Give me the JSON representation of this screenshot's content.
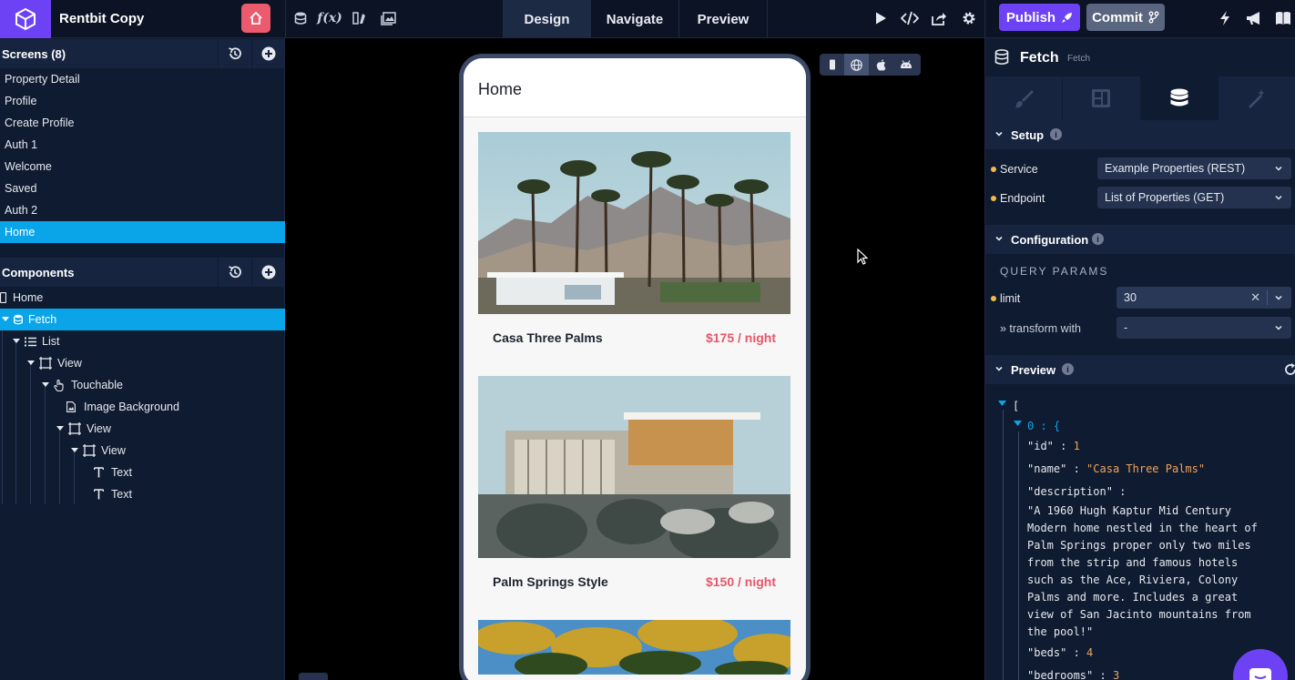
{
  "app": {
    "title": "Rentbit Copy"
  },
  "topbar": {
    "modes": [
      {
        "label": "Design",
        "active": true
      },
      {
        "label": "Navigate",
        "active": false
      },
      {
        "label": "Preview",
        "active": false
      }
    ],
    "publish_label": "Publish",
    "commit_label": "Commit",
    "tools": [
      "database-icon",
      "function-icon",
      "assets-icon",
      "image-gallery-icon"
    ],
    "right_icons": [
      "play-icon",
      "code-icon",
      "share-icon",
      "gear-icon",
      "lightning-icon",
      "megaphone-icon",
      "book-icon"
    ]
  },
  "screens": {
    "title": "Screens (8)",
    "items": [
      {
        "label": "Property Detail",
        "active": false
      },
      {
        "label": "Profile",
        "active": false
      },
      {
        "label": "Create Profile",
        "active": false
      },
      {
        "label": "Auth 1",
        "active": false
      },
      {
        "label": "Welcome",
        "active": false
      },
      {
        "label": "Saved",
        "active": false
      },
      {
        "label": "Auth 2",
        "active": false
      },
      {
        "label": "Home",
        "active": true
      }
    ]
  },
  "components": {
    "title": "Components",
    "tree": [
      {
        "label": "Home",
        "depth": 0,
        "icon": "screen-icon",
        "active": false
      },
      {
        "label": "Fetch",
        "depth": 0,
        "icon": "database-icon",
        "active": true
      },
      {
        "label": "List",
        "depth": 1,
        "icon": "list-icon",
        "active": false
      },
      {
        "label": "View",
        "depth": 2,
        "icon": "view-icon",
        "active": false
      },
      {
        "label": "Touchable",
        "depth": 3,
        "icon": "touch-icon",
        "active": false
      },
      {
        "label": "Image Background",
        "depth": 4,
        "icon": "image-file-icon",
        "active": false
      },
      {
        "label": "View",
        "depth": 4,
        "icon": "view-icon",
        "active": false
      },
      {
        "label": "View",
        "depth": 5,
        "icon": "view-icon",
        "active": false
      },
      {
        "label": "Text",
        "depth": 6,
        "icon": "text-icon",
        "active": false
      },
      {
        "label": "Text",
        "depth": 6,
        "icon": "text-icon",
        "active": false
      }
    ]
  },
  "phone": {
    "header_title": "Home",
    "cards": [
      {
        "name": "Casa Three Palms",
        "price": "$175 / night",
        "image": "desert-palms-house-image"
      },
      {
        "name": "Palm Springs Style",
        "price": "$150 / night",
        "image": "modern-glass-house-image"
      },
      {
        "name": "",
        "price": "",
        "image": "palm-trees-image"
      }
    ]
  },
  "inspector": {
    "title": "Fetch",
    "subtitle": "Fetch",
    "tabs": [
      "brush-icon",
      "layout-icon",
      "database-icon",
      "magic-wand-icon"
    ],
    "active_tab": 2,
    "setup": {
      "title": "Setup",
      "service_label": "Service",
      "service_value": "Example Properties (REST)",
      "endpoint_label": "Endpoint",
      "endpoint_value": "List of Properties (GET)"
    },
    "configuration": {
      "title": "Configuration",
      "query_params_label": "QUERY PARAMS",
      "limit_label": "limit",
      "limit_value": "30",
      "transform_label": "» transform with",
      "transform_value": "-"
    },
    "preview": {
      "title": "Preview",
      "open_bracket": "[",
      "index_label": "0 : {",
      "id_key": "\"id\"",
      "id_value": "1",
      "name_key": "\"name\"",
      "name_value": "\"Casa Three Palms\"",
      "description_key": "\"description\"",
      "description_lines": [
        "\"A 1960 Hugh Kaptur Mid Century",
        "Modern home nestled in the heart of",
        "Palm Springs proper only two miles",
        "from the strip and famous hotels",
        "such as the Ace, Riviera, Colony",
        "Palms and more. Includes a great",
        "view of San Jacinto mountains from",
        "the pool!\""
      ],
      "beds_key": "\"beds\"",
      "beds_value": "4",
      "bedrooms_key": "\"bedrooms\"",
      "bedrooms_value": "3"
    }
  },
  "colors": {
    "accent": "#6d42f5",
    "selection": "#0aa5e8",
    "price": "#e8566a",
    "json_value": "#f0a45a"
  }
}
